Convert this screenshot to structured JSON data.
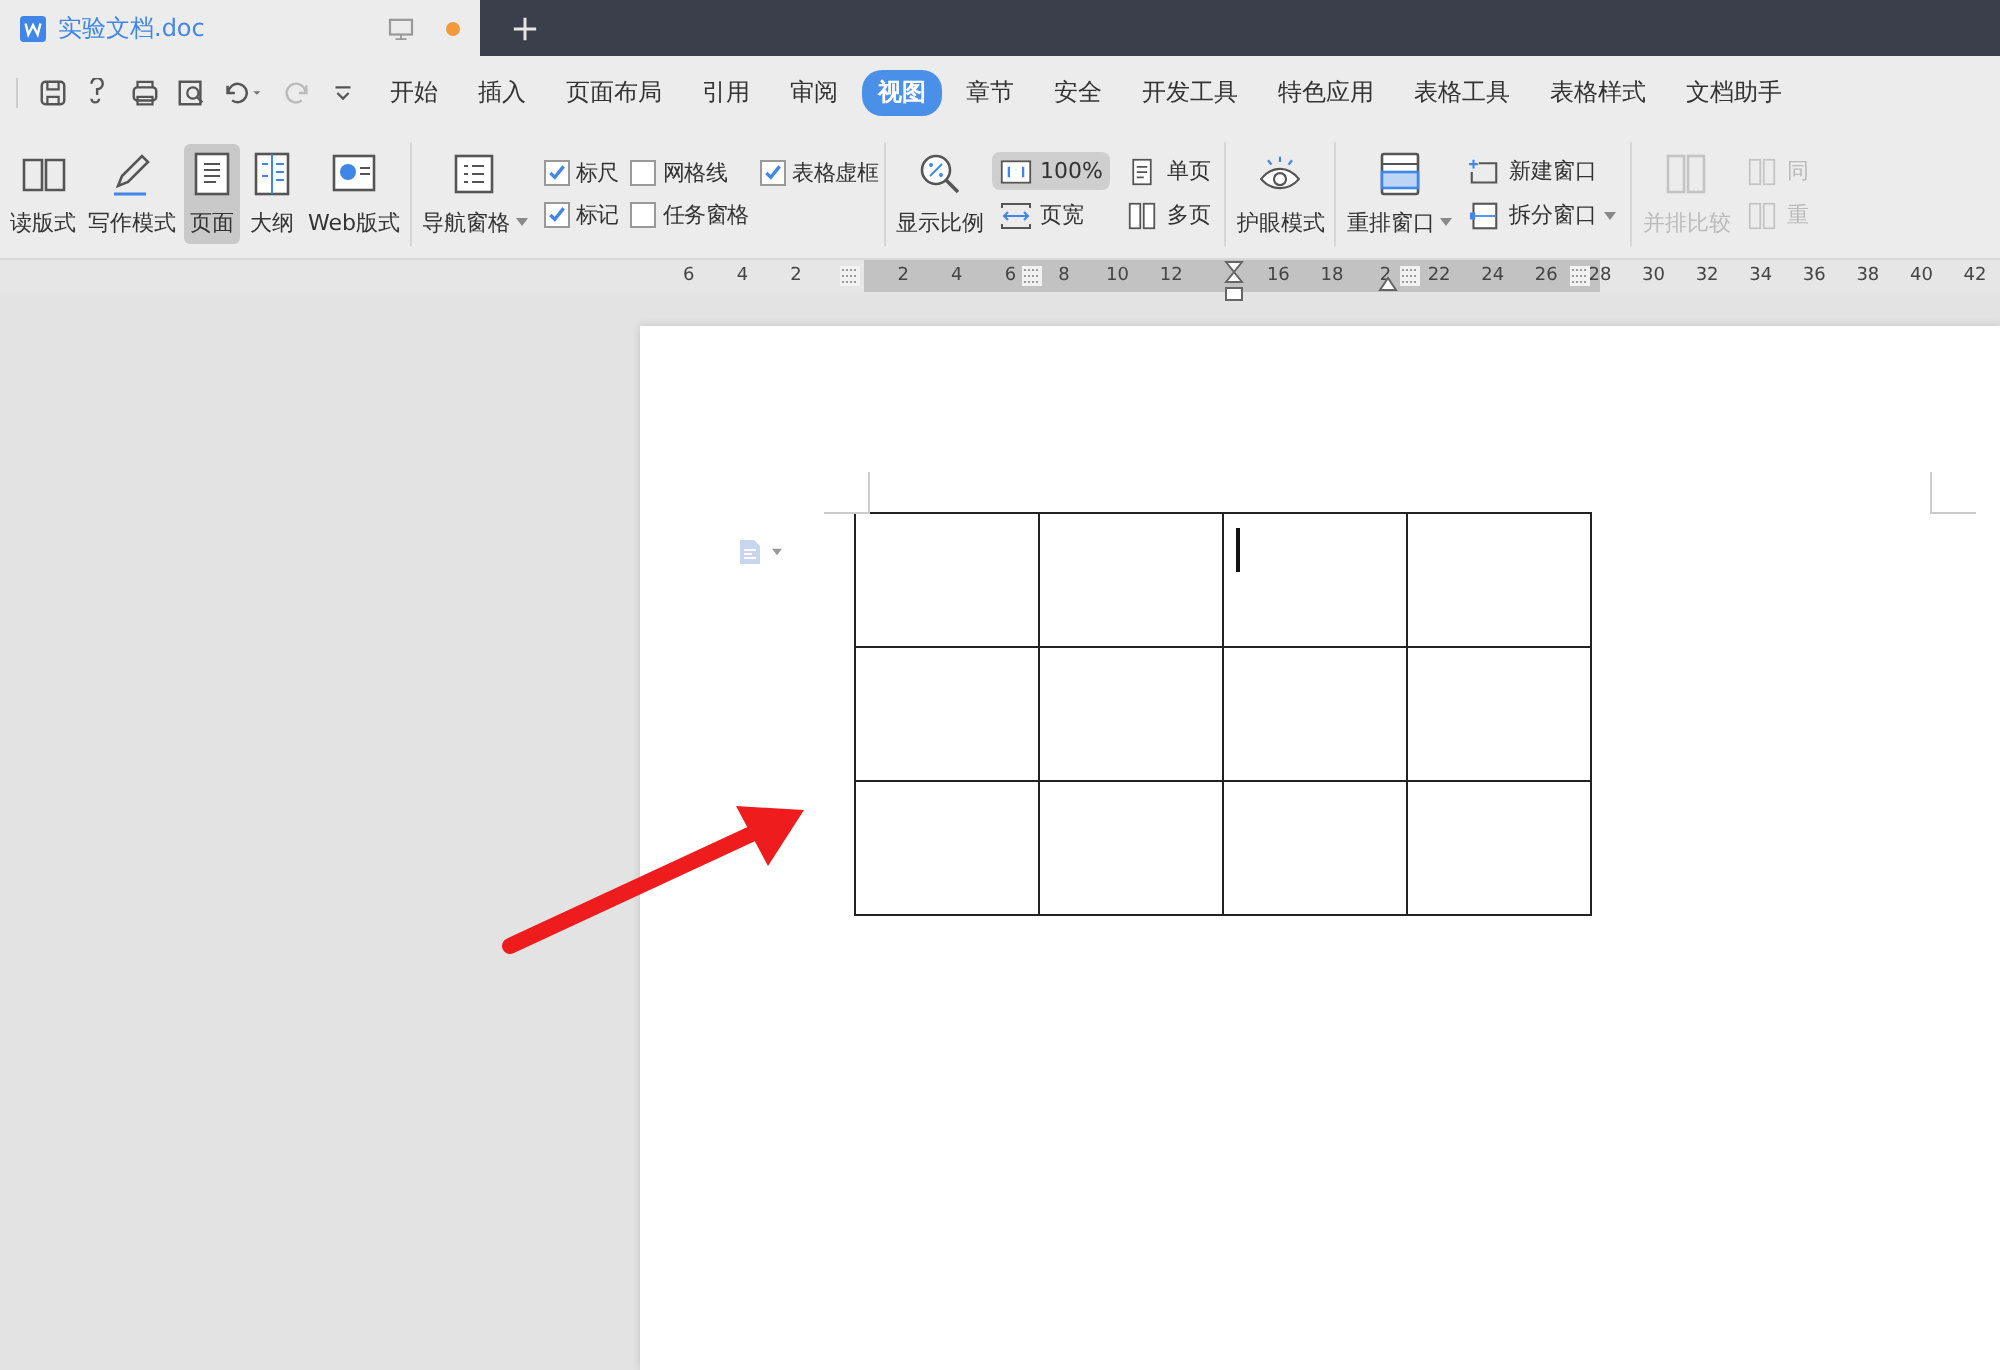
{
  "document_tab": {
    "title": "实验文档.doc",
    "unsaved": true
  },
  "menu": [
    {
      "label": "开始",
      "selected": false
    },
    {
      "label": "插入",
      "selected": false
    },
    {
      "label": "页面布局",
      "selected": false
    },
    {
      "label": "引用",
      "selected": false
    },
    {
      "label": "审阅",
      "selected": false
    },
    {
      "label": "视图",
      "selected": true
    },
    {
      "label": "章节",
      "selected": false
    },
    {
      "label": "安全",
      "selected": false
    },
    {
      "label": "开发工具",
      "selected": false
    },
    {
      "label": "特色应用",
      "selected": false
    },
    {
      "label": "表格工具",
      "selected": false
    },
    {
      "label": "表格样式",
      "selected": false
    },
    {
      "label": "文档助手",
      "selected": false
    }
  ],
  "view_modes": [
    {
      "label": "读版式",
      "selected": false
    },
    {
      "label": "写作模式",
      "selected": false
    },
    {
      "label": "页面",
      "selected": true
    },
    {
      "label": "大纲",
      "selected": false
    },
    {
      "label": "Web版式",
      "selected": false
    }
  ],
  "nav_pane": {
    "label": "导航窗格"
  },
  "show_options": [
    {
      "label": "标尺",
      "checked": true
    },
    {
      "label": "标记",
      "checked": true
    },
    {
      "label": "网格线",
      "checked": false
    },
    {
      "label": "任务窗格",
      "checked": false
    },
    {
      "label": "表格虚框",
      "checked": true
    }
  ],
  "zoom": {
    "label": "显示比例"
  },
  "page_fit": [
    {
      "label": "100%",
      "selected": true
    },
    {
      "label": "页宽",
      "selected": false
    },
    {
      "label": "单页",
      "selected": false
    },
    {
      "label": "多页",
      "selected": false
    }
  ],
  "eye_care": {
    "label": "护眼模式"
  },
  "arrange": {
    "label": "重排窗口"
  },
  "window_actions": [
    {
      "label": "新建窗口"
    },
    {
      "label": "拆分窗口"
    }
  ],
  "compare": {
    "label": "并排比较",
    "disabled": true
  },
  "sync": [
    {
      "label": "同",
      "disabled": true
    },
    {
      "label": "重",
      "disabled": true
    }
  ],
  "ruler": {
    "ticks": [
      "6",
      "4",
      "2",
      "2",
      "4",
      "6",
      "8",
      "10",
      "12",
      "16",
      "18",
      "2",
      "22",
      "24",
      "26",
      "28",
      "30",
      "32",
      "34",
      "36",
      "38",
      "40",
      "42"
    ]
  },
  "table": {
    "rows": [
      {
        "cells": [
          {
            "cursor": false
          },
          {
            "cursor": false
          },
          {
            "cursor": true
          },
          {
            "cursor": false
          }
        ]
      },
      {
        "cells": [
          {
            "cursor": false
          },
          {
            "cursor": false
          },
          {
            "cursor": false
          },
          {
            "cursor": false
          }
        ]
      },
      {
        "cells": [
          {
            "cursor": false
          },
          {
            "cursor": false
          },
          {
            "cursor": false
          },
          {
            "cursor": false
          }
        ]
      }
    ]
  }
}
